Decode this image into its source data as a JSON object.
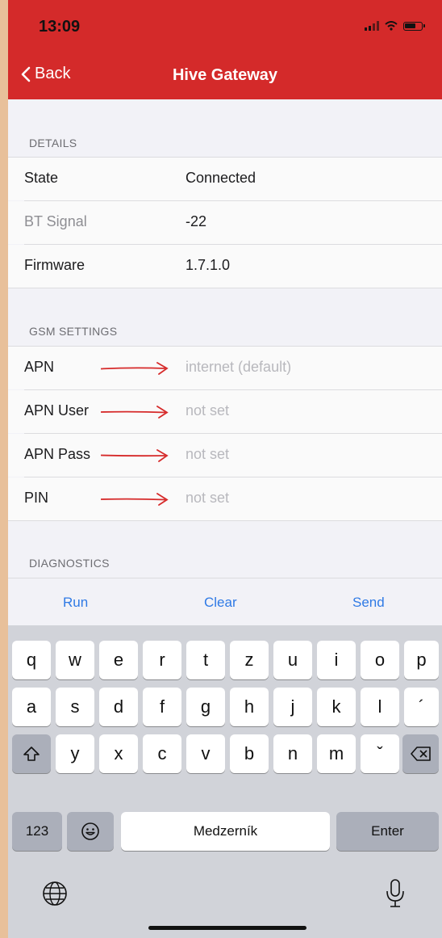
{
  "status_bar": {
    "time": "13:09"
  },
  "nav": {
    "back_label": "Back",
    "title": "Hive Gateway"
  },
  "colors": {
    "nav_bar": "#d42a2a",
    "link": "#2f7ae5",
    "annotation_arrow": "#d62a2a"
  },
  "details": {
    "header": "DETAILS",
    "rows": [
      {
        "label": "State",
        "value": "Connected"
      },
      {
        "label": "BT Signal",
        "value": "-22"
      },
      {
        "label": "Firmware",
        "value": "1.7.1.0"
      }
    ]
  },
  "gsm": {
    "header": "GSM SETTINGS",
    "rows": [
      {
        "label": "APN",
        "placeholder": "internet (default)"
      },
      {
        "label": "APN User",
        "placeholder": "not set"
      },
      {
        "label": "APN Pass",
        "placeholder": "not set"
      },
      {
        "label": "PIN",
        "placeholder": "not set"
      }
    ]
  },
  "diagnostics": {
    "header": "DIAGNOSTICS",
    "actions": {
      "run": "Run",
      "clear": "Clear",
      "send": "Send"
    }
  },
  "keyboard": {
    "row1": [
      "q",
      "w",
      "e",
      "r",
      "t",
      "z",
      "u",
      "i",
      "o",
      "p"
    ],
    "row2": [
      "a",
      "s",
      "d",
      "f",
      "g",
      "h",
      "j",
      "k",
      "l",
      "´"
    ],
    "row3": [
      "y",
      "x",
      "c",
      "v",
      "b",
      "n",
      "m",
      "ˇ"
    ],
    "numbers_label": "123",
    "space_label": "Medzerník",
    "enter_label": "Enter",
    "icons": [
      "shift-icon",
      "delete-icon",
      "emoji-icon",
      "globe-icon",
      "microphone-icon"
    ]
  }
}
